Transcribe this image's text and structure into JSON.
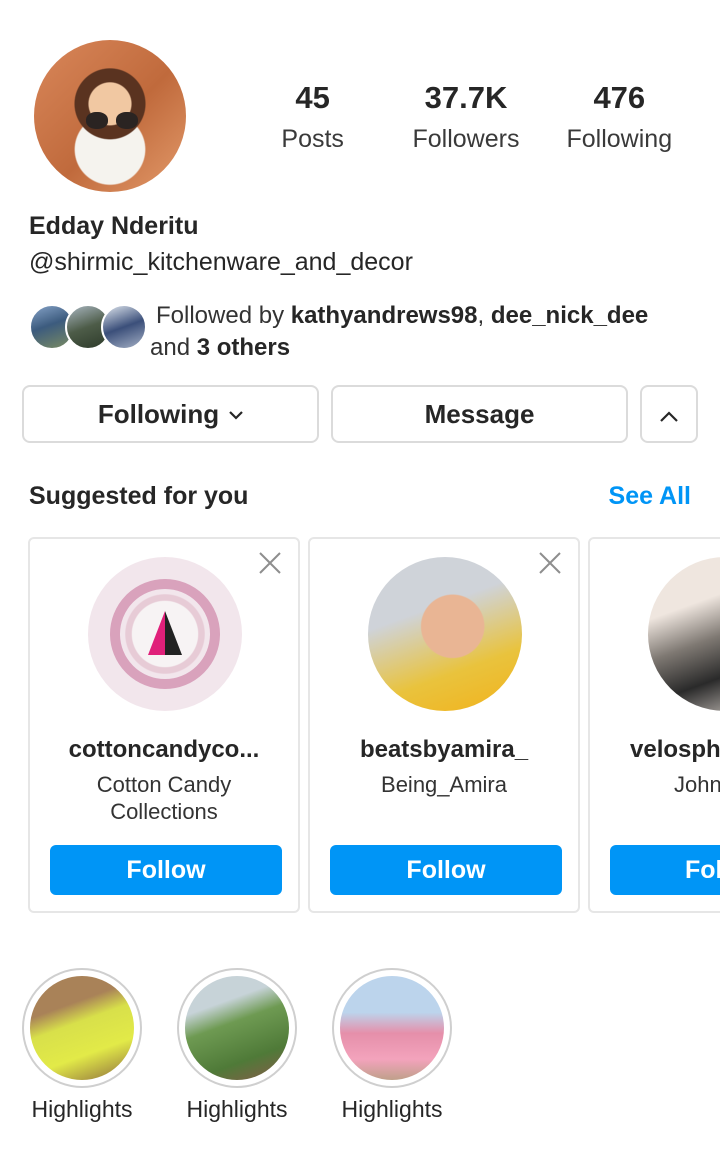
{
  "profile": {
    "name": "Edday Nderitu",
    "handle": "@shirmic_kitchenware_and_decor",
    "stats": [
      {
        "value": "45",
        "label": "Posts"
      },
      {
        "value": "37.7K",
        "label": "Followers"
      },
      {
        "value": "476",
        "label": "Following"
      }
    ],
    "followed_by": {
      "prefix": "Followed by ",
      "user1": "kathyandrews98",
      "sep": ", ",
      "user2": "dee_nick_dee",
      "and": " and ",
      "others": "3 others"
    }
  },
  "actions": {
    "following_label": "Following",
    "message_label": "Message"
  },
  "suggested": {
    "title": "Suggested for you",
    "see_all": "See All",
    "cards": [
      {
        "username": "cottoncandyco...",
        "full_name_line1": "Cotton Candy",
        "full_name_line2": "Collections",
        "follow": "Follow"
      },
      {
        "username": "beatsbyamira_",
        "full_name_line1": "Being_Amira",
        "full_name_line2": "",
        "follow": "Follow"
      },
      {
        "username": "velosph",
        "full_name_line1": "John",
        "full_name_line2": "",
        "follow": "Fol"
      }
    ]
  },
  "highlights": [
    {
      "label": "Highlights"
    },
    {
      "label": "Highlights"
    },
    {
      "label": "Highlights"
    }
  ],
  "colors": {
    "accent": "#0095f6",
    "text": "#262626",
    "border": "#dbdbdb"
  }
}
